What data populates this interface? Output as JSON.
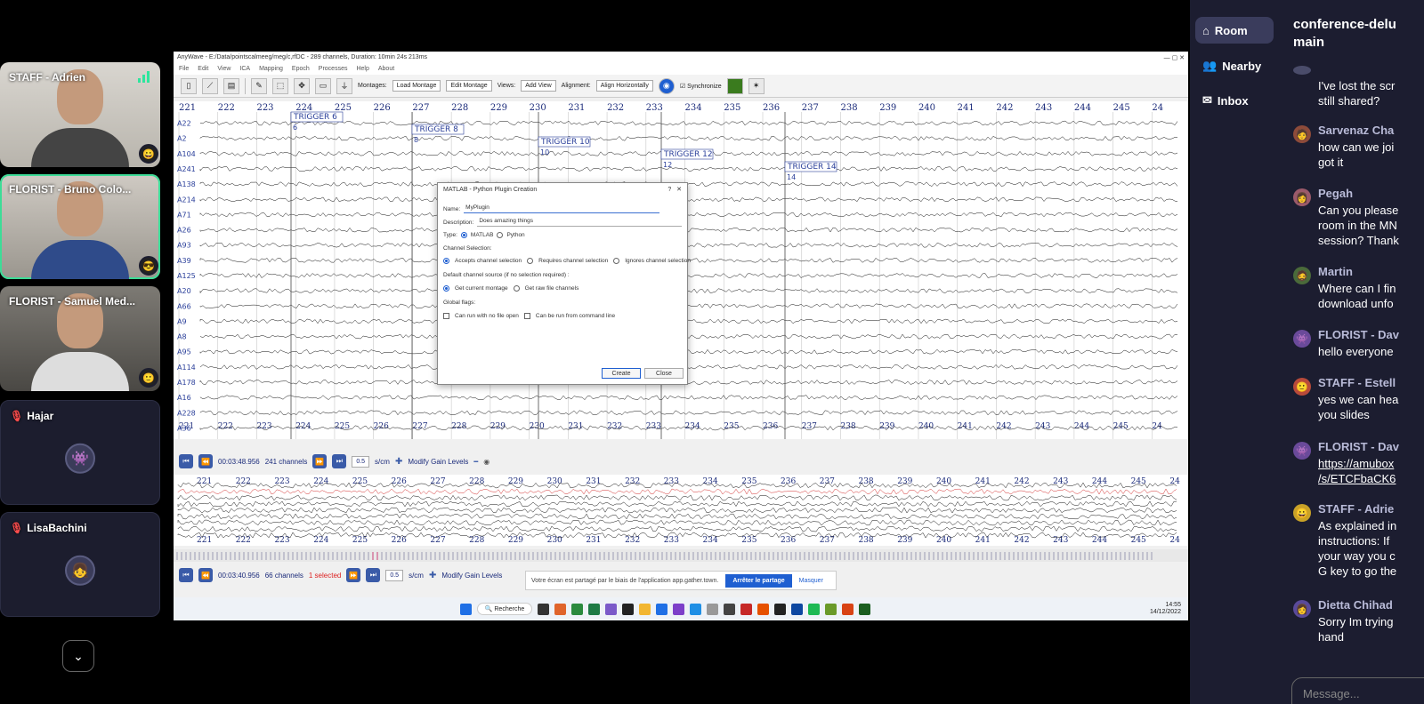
{
  "participants": [
    {
      "name": "STAFF - Adrien"
    },
    {
      "name": "FLORIST - Bruno Colo..."
    },
    {
      "name": "FLORIST - Samuel Med..."
    },
    {
      "name": "Hajar"
    },
    {
      "name": "LisaBachini"
    }
  ],
  "app": {
    "title": "AnyWave - E:/Data/pointscalmeeg/meg/c,rfDC - 289 channels, Duration: 10min 24s 213ms",
    "menu": [
      "File",
      "Edit",
      "View",
      "ICA",
      "Mapping",
      "Epoch",
      "Processes",
      "Help",
      "About"
    ],
    "toolbar": {
      "montages_label": "Montages:",
      "load_montage": "Load Montage",
      "edit_montage": "Edit Montage",
      "views_label": "Views:",
      "add_view": "Add View",
      "alignment_label": "Alignment:",
      "alignment_value": "Align Horizontally",
      "synchronize": "Synchronize"
    },
    "time_ticks": [
      "221",
      "222",
      "223",
      "224",
      "225",
      "226",
      "227",
      "228",
      "229",
      "230",
      "231",
      "232",
      "233",
      "234",
      "235",
      "236",
      "237",
      "238",
      "239",
      "240",
      "241",
      "242",
      "243",
      "244",
      "245",
      "24"
    ],
    "channels": [
      "A22",
      "A2",
      "A104",
      "A241",
      "A138",
      "A214",
      "A71",
      "A26",
      "A93",
      "A39",
      "A125",
      "A20",
      "A66",
      "A9",
      "A8",
      "A95",
      "A114",
      "A178",
      "A16",
      "A228",
      "A36"
    ],
    "triggers": [
      {
        "label": "TRIGGER 6",
        "num": "6"
      },
      {
        "label": "TRIGGER 8",
        "num": "8"
      },
      {
        "label": "TRIGGER 10",
        "num": "10"
      },
      {
        "label": "TRIGGER 12",
        "num": "12"
      },
      {
        "label": "TRIGGER 14",
        "num": "14"
      }
    ],
    "view1": {
      "time": "00:03:48.956",
      "channels": "241 channels",
      "scale": "0.5",
      "unit": "s/cm",
      "gain": "Modify Gain Levels"
    },
    "view2": {
      "time": "00:03:40.956",
      "channels": "66 channels",
      "selected": "1 selected",
      "scale": "0.5",
      "unit": "s/cm",
      "gain": "Modify Gain Levels"
    }
  },
  "dialog": {
    "title": "MATLAB - Python Plugin Creation",
    "help": "?",
    "close_x": "✕",
    "name_label": "Name:",
    "name_value": "MyPlugin",
    "desc_label": "Description:",
    "desc_value": "Does amazing things",
    "type_label": "Type:",
    "type_matlab": "MATLAB",
    "type_python": "Python",
    "channel_selection": "Channel Selection:",
    "accepts": "Accepts channel selection",
    "requires": "Requires channel selection",
    "ignores": "Ignores channel selection",
    "default_source": "Default channel source (if no selection required) :",
    "current_montage": "Get current montage",
    "raw_file": "Get raw file channels",
    "global_flags": "Global flags:",
    "no_file": "Can run with no file open",
    "command_line": "Can be run from command line",
    "create": "Create",
    "close": "Close"
  },
  "share": {
    "text": "Votre écran est partagé par le biais de l'application app.gather.town.",
    "stop": "Arrêter le partage",
    "hide": "Masquer"
  },
  "taskbar": {
    "search": "Recherche",
    "time": "14:55",
    "date": "14/12/2022"
  },
  "nav": {
    "room": "Room",
    "nearby": "Nearby",
    "inbox": "Inbox"
  },
  "chat": {
    "title_line1": "conference-delu",
    "title_line2": "main",
    "placeholder": "Message...",
    "messages": [
      {
        "author": "",
        "text": "I've lost the scr\nstill shared?"
      },
      {
        "author": "Sarvenaz Cha",
        "text": "how can we joi\ngot it"
      },
      {
        "author": "Pegah",
        "text": "Can you please\nroom in the MN\nsession? Thank"
      },
      {
        "author": "Martin",
        "text": "Where can I fin\ndownload unfo"
      },
      {
        "author": "FLORIST - Dav",
        "text": "hello everyone"
      },
      {
        "author": "STAFF - Estell",
        "text": "yes we can hea\nyou slides"
      },
      {
        "author": "FLORIST - Dav",
        "text": "https://amubox\n/s/ETCFbaCK6"
      },
      {
        "author": "STAFF - Adrie",
        "text": "As explained in\ninstructions: If\nyour way you c\nG key to go the"
      },
      {
        "author": "Dietta Chihad",
        "text": "Sorry Im trying\nhand"
      }
    ]
  },
  "colors": {
    "accent": "#3ddc97",
    "trace": "#111111",
    "trigger": "#2a3f9a",
    "link": "#1f5fd1",
    "sidebar": "#1c1d30"
  }
}
